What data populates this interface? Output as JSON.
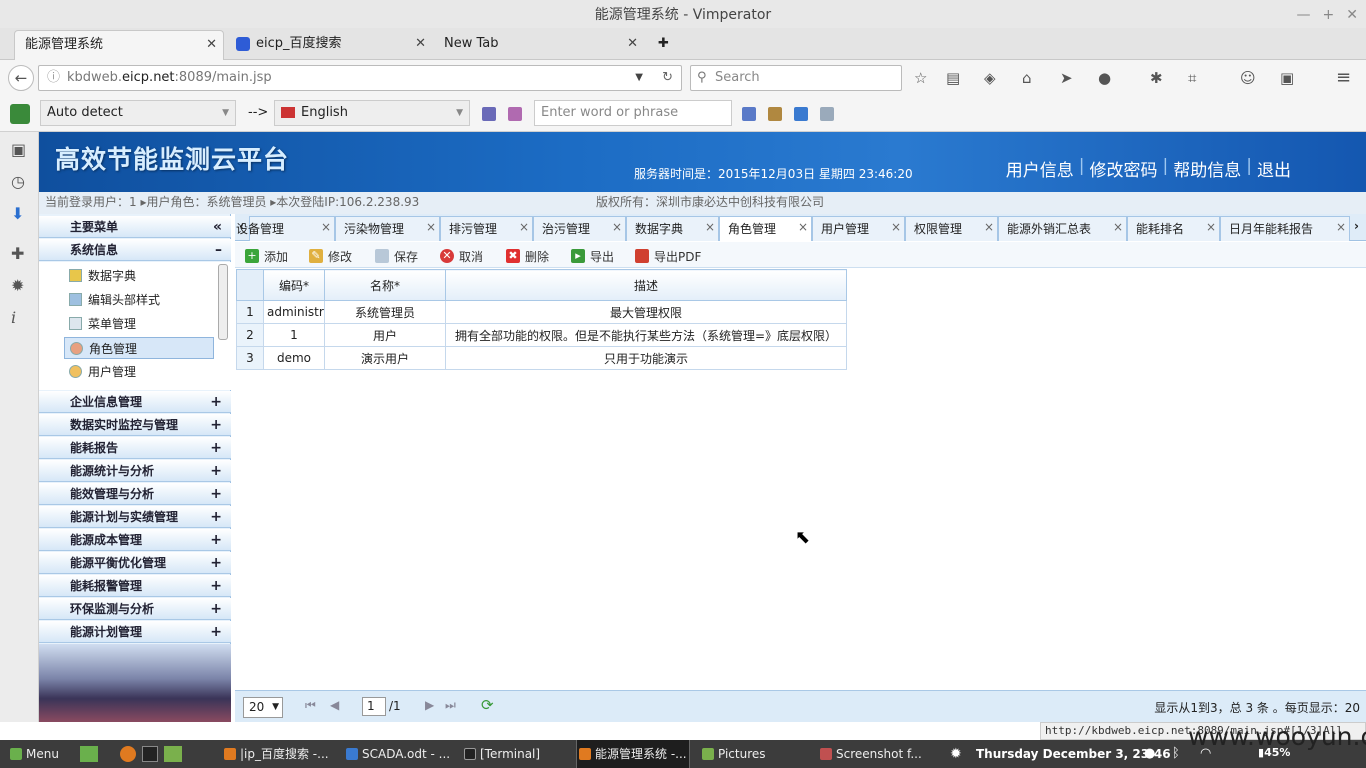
{
  "window": {
    "title": "能源管理系统 - Vimperator"
  },
  "browser_tabs": [
    {
      "label": "能源管理系统"
    },
    {
      "label": "eicp_百度搜索"
    },
    {
      "label": "New Tab"
    }
  ],
  "address": {
    "prefix": "kbdweb.",
    "domain": "eicp.net",
    "suffix": ":8089/main.jsp"
  },
  "search": {
    "placeholder": "Search"
  },
  "translate": {
    "source": "Auto detect",
    "arrow": "-->",
    "target": "English",
    "placeholder": "Enter word or phrase"
  },
  "app": {
    "logo": "高效节能监测云平台",
    "server_time": "服务器时间是：2015年12月03日 星期四 23:46:20",
    "top_links": [
      "用户信息",
      "修改密码",
      "帮助信息",
      "退出"
    ],
    "login_info": "当前登录用户：1 ▸用户角色：系统管理员 ▸本次登陆IP:106.2.238.93",
    "copyright": "版权所有：深圳市康必达中创科技有限公司"
  },
  "sidebar": {
    "main_menu": "主要菜单",
    "system_info": "系统信息",
    "sub_items": [
      "数据字典",
      "编辑头部样式",
      "菜单管理",
      "角色管理",
      "用户管理"
    ],
    "groups": [
      "企业信息管理",
      "数据实时监控与管理",
      "能耗报告",
      "能源统计与分析",
      "能效管理与分析",
      "能源计划与实绩管理",
      "能源成本管理",
      "能源平衡优化管理",
      "能耗报警管理",
      "环保监测与分析",
      "能源计划管理"
    ]
  },
  "content_tabs": [
    "设备管理",
    "污染物管理",
    "排污管理",
    "治污管理",
    "数据字典",
    "角色管理",
    "用户管理",
    "权限管理",
    "能源外销汇总表",
    "能耗排名",
    "日月年能耗报告"
  ],
  "toolbar": {
    "add": "添加",
    "edit": "修改",
    "save": "保存",
    "cancel": "取消",
    "delete": "删除",
    "export": "导出",
    "export_pdf": "导出PDF"
  },
  "table": {
    "columns": [
      "编码*",
      "名称*",
      "描述"
    ],
    "rows": [
      {
        "n": "1",
        "code": "administrator",
        "name": "系统管理员",
        "desc": "最大管理权限"
      },
      {
        "n": "2",
        "code": "1",
        "name": "用户",
        "desc": "拥有全部功能的权限。但是不能执行某些方法（系统管理=》底层权限）"
      },
      {
        "n": "3",
        "code": "demo",
        "name": "演示用户",
        "desc": "只用于功能演示"
      }
    ]
  },
  "pager": {
    "page_size": "20",
    "page": "1",
    "total_pages": "/1",
    "info": "显示从1到3，总 3 条 。每页显示：20"
  },
  "status_url": "http://kbdweb.eicp.net:8089/main.jsp#[1/3]All",
  "taskbar": {
    "menu": "Menu",
    "items": [
      "|ip_百度搜索 -...",
      "SCADA.odt - ...",
      "[Terminal]",
      "能源管理系统 -...",
      "Pictures",
      "Screenshot f..."
    ],
    "clock": "Thursday December  3, 23:46",
    "battery": "45%"
  },
  "watermark": "www.wooyun.org"
}
